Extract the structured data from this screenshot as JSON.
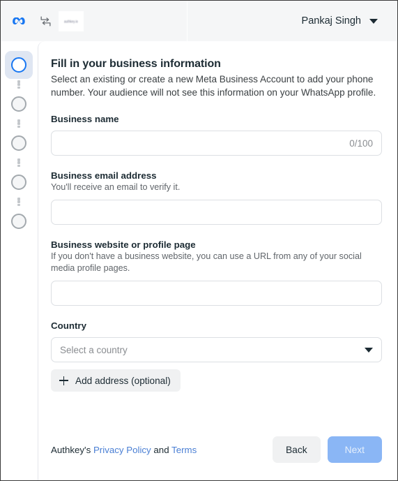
{
  "header": {
    "meta_logo": "meta-logo",
    "swap_icon": "swap-icon",
    "partner_logo_text": "authkey.io",
    "user_name": "Pankaj Singh",
    "user_caret": "chevron-down-icon"
  },
  "stepper": {
    "steps": [
      {
        "index": 1,
        "state": "active"
      },
      {
        "index": 2,
        "state": "inactive"
      },
      {
        "index": 3,
        "state": "inactive"
      },
      {
        "index": 4,
        "state": "inactive"
      },
      {
        "index": 5,
        "state": "inactive"
      }
    ]
  },
  "main": {
    "title": "Fill in your business information",
    "subtitle": "Select an existing or create a new Meta Business Account to add your phone number. Your audience will not see this information on your WhatsApp profile.",
    "fields": {
      "business_name": {
        "label": "Business name",
        "value": "",
        "counter": "0/100"
      },
      "business_email": {
        "label": "Business email address",
        "help": "You'll receive an email to verify it.",
        "value": ""
      },
      "business_website": {
        "label": "Business website or profile page",
        "help": "If you don't have a business website, you can use a URL from any of your social media profile pages.",
        "value": ""
      },
      "country": {
        "label": "Country",
        "placeholder": "Select a country",
        "value": "",
        "caret": "chevron-down-icon"
      }
    },
    "add_address_button": {
      "label": "Add address (optional)",
      "icon": "plus-icon"
    }
  },
  "footer": {
    "legal_prefix": "Authkey's ",
    "privacy_link": "Privacy Policy",
    "legal_conjunction": " and ",
    "terms_link": "Terms",
    "back_label": "Back",
    "next_label": "Next"
  },
  "colors": {
    "brand_blue": "#1877f2",
    "link_blue": "#4a7fd4",
    "next_disabled": "#8ab6f5",
    "header_bg": "#f5f6f7",
    "step_active_bg": "#dfe6f2"
  }
}
